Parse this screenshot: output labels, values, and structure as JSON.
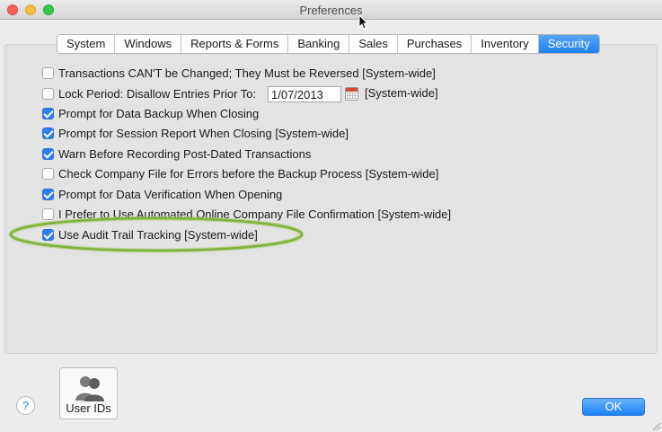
{
  "window": {
    "title": "Preferences"
  },
  "tabs": [
    {
      "label": "System"
    },
    {
      "label": "Windows"
    },
    {
      "label": "Reports & Forms"
    },
    {
      "label": "Banking"
    },
    {
      "label": "Sales"
    },
    {
      "label": "Purchases"
    },
    {
      "label": "Inventory"
    },
    {
      "label": "Security",
      "active": true
    }
  ],
  "options": [
    {
      "label": "Transactions CAN'T be Changed; They Must be Reversed [System-wide]",
      "checked": false
    },
    {
      "label": "Lock Period: Disallow Entries Prior To:",
      "checked": false
    },
    {
      "label": "Prompt for Data Backup When Closing",
      "checked": true
    },
    {
      "label": "Prompt for Session Report When Closing [System-wide]",
      "checked": true
    },
    {
      "label": "Warn Before Recording Post-Dated Transactions",
      "checked": true
    },
    {
      "label": "Check Company File for Errors before the Backup Process [System-wide]",
      "checked": false
    },
    {
      "label": "Prompt for Data Verification When Opening",
      "checked": true
    },
    {
      "label": "I Prefer to Use Automated Online Company File Confirmation [System-wide]",
      "checked": false
    },
    {
      "label": "Use Audit Trail Tracking [System-wide]",
      "checked": true
    }
  ],
  "lock_period": {
    "date": "1/07/2013",
    "suffix": "[System-wide]"
  },
  "buttons": {
    "help": "?",
    "user_ids": "User IDs",
    "ok": "OK"
  },
  "colors": {
    "accent": "#2e7cf6",
    "highlight_ring": "#7fb23a"
  },
  "icons": {
    "calendar": "calendar-icon",
    "users": "users-icon",
    "cursor": "cursor-arrow-icon"
  }
}
